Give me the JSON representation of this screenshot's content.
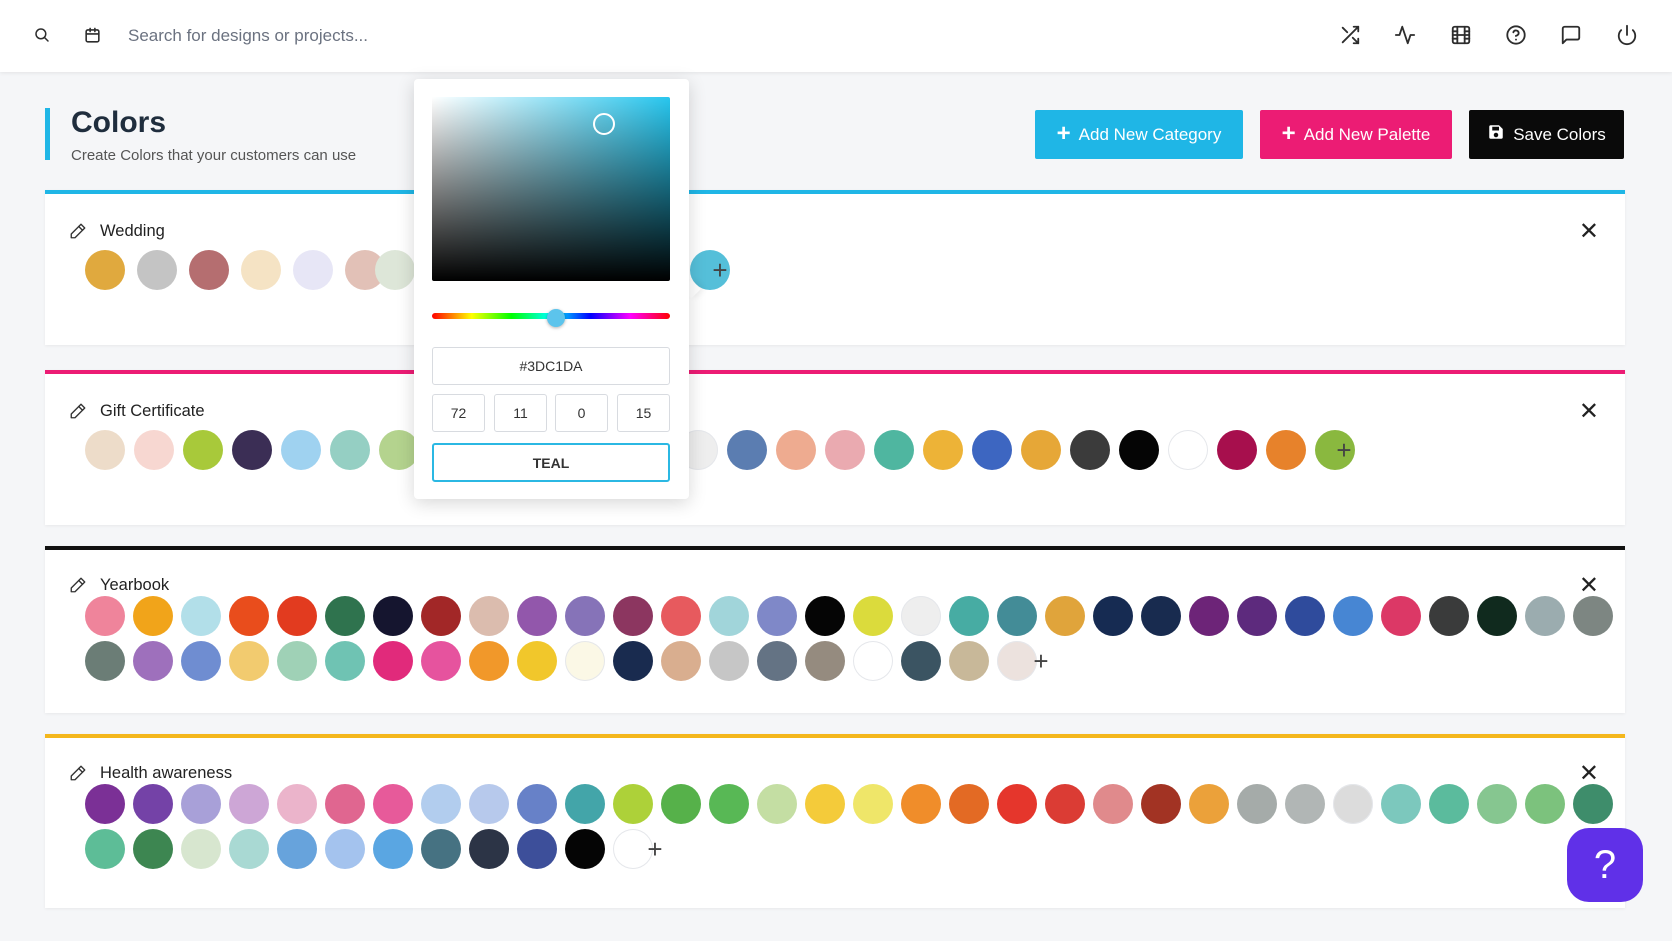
{
  "topbar": {
    "search_placeholder": "Search for designs or projects...",
    "icons": [
      "search-icon",
      "calendar-icon",
      "shuffle-icon",
      "activity-icon",
      "film-icon",
      "help-circle-icon",
      "message-icon",
      "power-icon"
    ]
  },
  "header": {
    "title": "Colors",
    "subtitle": "Create Colors that your customers can use",
    "accent": "#1fb6e6"
  },
  "actions": {
    "add_category": "Add New Category",
    "add_palette": "Add New Palette",
    "save": "Save Colors"
  },
  "picker": {
    "hex": "#3DC1DA",
    "cmyk": [
      "72",
      "11",
      "0",
      "15"
    ],
    "name": "TEAL",
    "hue_level_pct": 52
  },
  "categories": [
    {
      "name": "Wedding",
      "bar_color": "#1fb6e6",
      "swatches": [
        "#e0a93e",
        "#c4c4c4",
        "#b56e70",
        "#f5e3c4",
        "#e7e6f6",
        "#e2c1b7",
        "#dde6d8",
        "#55bfd9"
      ]
    },
    {
      "name": "Gift Certificate",
      "bar_color": "#ec1c74",
      "swatches": [
        "#eddcc9",
        "#f7d7d1",
        "#a8c93a",
        "#3b2e55",
        "#9fd2f0",
        "#95cfc3",
        "#b4d38e",
        "#eeeeee",
        "#5b7db1",
        "#eeab90",
        "#eaaab0",
        "#4fb6a0",
        "#edb337",
        "#3d66c1",
        "#e6a737",
        "#3b3b3b",
        "#050505",
        "#ffffff",
        "#a70f4d",
        "#e7822b",
        "#8ab83f"
      ]
    },
    {
      "name": "Yearbook",
      "bar_color": "#111111",
      "swatches": [
        "#ef849b",
        "#f1a41a",
        "#b2dfe9",
        "#e94d1c",
        "#e23b1f",
        "#2f734e",
        "#15152f",
        "#a22727",
        "#dbbcae",
        "#9257ab",
        "#8673b8",
        "#8c3660",
        "#e75a5e",
        "#a1d5da",
        "#7f88c8",
        "#050505",
        "#dbdb3c",
        "#eeeeee",
        "#47aca3",
        "#438c97",
        "#e0a43b",
        "#162b52",
        "#182b4f",
        "#6d2478",
        "#5d2a7d",
        "#2f4b9c",
        "#4786d3",
        "#dc3866",
        "#3a3b3b",
        "#102a1e",
        "#9bacaf",
        "#7d8682",
        "#6b7d76",
        "#9e70bc",
        "#6f8dd1",
        "#f2cb6f",
        "#9fd1b6",
        "#6fc3b3",
        "#e12a7b",
        "#e6539e",
        "#f1982a",
        "#f1c72b",
        "#fbf8e6",
        "#192b4f",
        "#d9ae8f",
        "#c6c6c6",
        "#647384",
        "#958b7f",
        "#ffffff",
        "#3b5462",
        "#c8b899",
        "#ece2de"
      ]
    },
    {
      "name": "Health awareness",
      "bar_color": "#f4b71c",
      "swatches": [
        "#7b3096",
        "#7442a7",
        "#a8a0d8",
        "#cda6d6",
        "#ebb4cb",
        "#e06690",
        "#e75a9a",
        "#b2cdee",
        "#b7c9ec",
        "#6781c8",
        "#43a5a9",
        "#add139",
        "#56b14a",
        "#58b855",
        "#c4dea3",
        "#f4cb3a",
        "#efe669",
        "#f08d2a",
        "#e36a24",
        "#e5362c",
        "#db3c34",
        "#e08a8c",
        "#a23323",
        "#eba13a",
        "#a5aba9",
        "#b1b6b5",
        "#dcdcdc",
        "#7cc8bd",
        "#5bbb9d",
        "#86c690",
        "#7cc27d",
        "#3e8d6b",
        "#5dbd97",
        "#3d8651",
        "#d7e6cf",
        "#a9d9d3",
        "#67a3dc",
        "#a4c3ee",
        "#5aa6e2",
        "#467282",
        "#2c3446",
        "#3d4f9a",
        "#050505",
        "#ffffff"
      ]
    }
  ],
  "help_fab": "?"
}
